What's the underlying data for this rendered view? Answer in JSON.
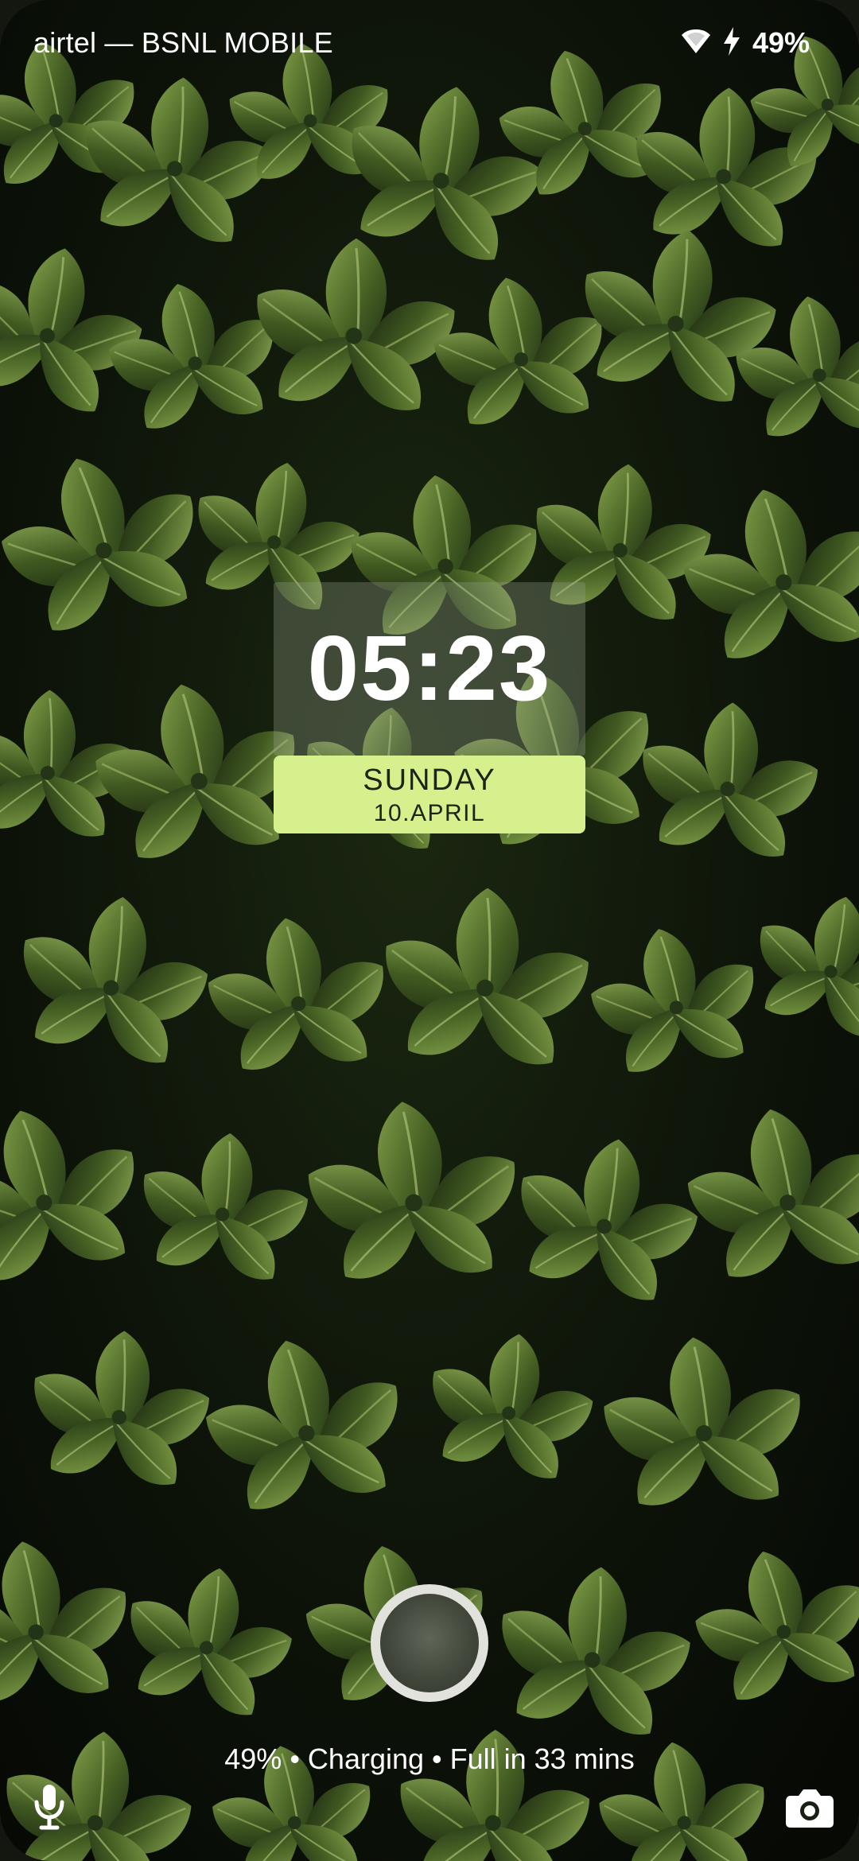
{
  "status_bar": {
    "carrier": "airtel — BSNL MOBILE",
    "wifi_icon": "wifi-icon",
    "charging_icon": "charging-bolt-icon",
    "battery_percent": "49%"
  },
  "clock": {
    "time": "05:23",
    "day": "SUNDAY",
    "date": "10.APRIL"
  },
  "lockscreen": {
    "unlock_icon": "unlock-circle",
    "charging_status": "49% • Charging • Full in 33 mins",
    "mic_icon": "mic-icon",
    "camera_icon": "camera-icon"
  },
  "colors": {
    "date_panel": "#d6f08d",
    "text": "#ffffff",
    "leaf_dark": "#33471e",
    "leaf_light": "#8ea852"
  }
}
